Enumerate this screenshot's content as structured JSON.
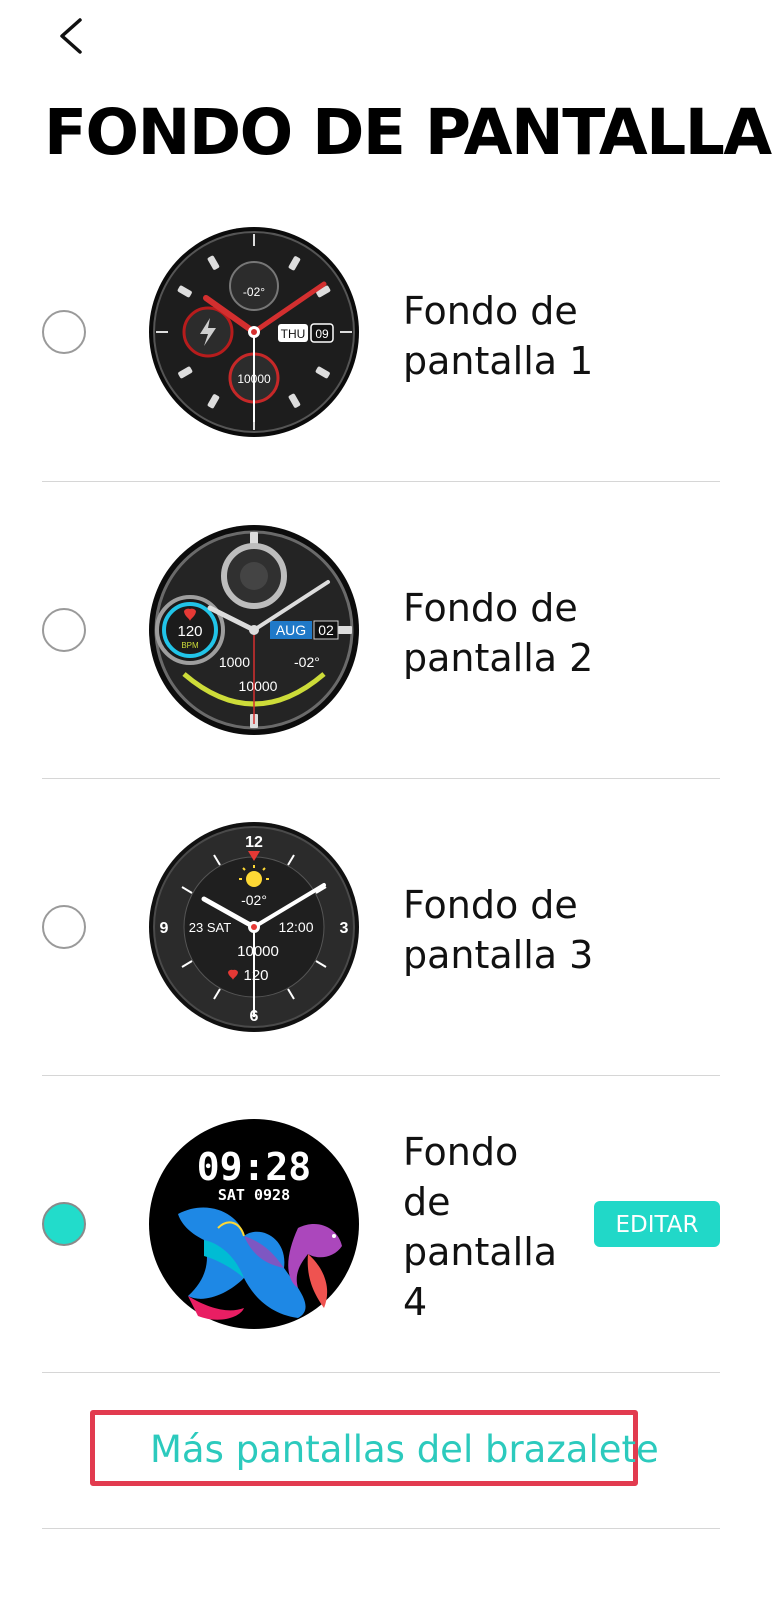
{
  "header": {
    "back_icon": "chevron-left-icon",
    "title": "FONDO DE PANTALLA"
  },
  "wallpapers": [
    {
      "label": "Fondo de pantalla 1",
      "selected": false,
      "dial": {
        "complication": "-02°",
        "date": "THU",
        "day": "09",
        "steps": "10000"
      }
    },
    {
      "label": "Fondo de pantalla 2",
      "selected": false,
      "dial": {
        "heart_rate": "120",
        "heart_unit": "BPM",
        "month": "AUG",
        "day": "02",
        "calories": "1000",
        "temp": "-02°",
        "steps": "10000"
      }
    },
    {
      "label": "Fondo de pantalla 3",
      "selected": false,
      "dial": {
        "temp": "-02°",
        "date": "23 SAT",
        "time": "12:00",
        "steps": "10000",
        "heart_rate": "120"
      }
    },
    {
      "label": "Fondo de pantalla 4",
      "selected": true,
      "edit_label": "EDITAR",
      "dial": {
        "time": "09:28",
        "date": "SAT 0928"
      }
    }
  ],
  "more_link": "Más pantallas del brazalete",
  "colors": {
    "accent": "#21d8c8",
    "link": "#2ccabd",
    "highlight_border": "#e23b4f"
  }
}
